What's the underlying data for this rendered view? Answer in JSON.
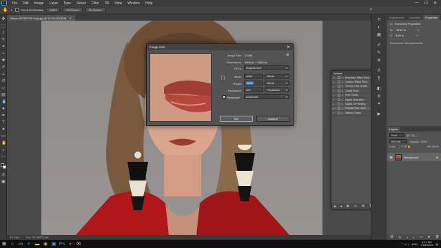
{
  "menu": [
    "File",
    "Edit",
    "Image",
    "Layer",
    "Type",
    "Select",
    "Filter",
    "3D",
    "View",
    "Window",
    "Help"
  ],
  "window_controls": [
    "—",
    "☐",
    "✕"
  ],
  "options": {
    "check_label": "Scroll All Windows",
    "zoom": "100%",
    "fit_screen": "Fit Screen",
    "fill_screen": "Fill Screen"
  },
  "doc_tab": {
    "label": "iStock-997500766 copy.jpg @ 33.3% (RGB/8)",
    "close": "✕"
  },
  "status": {
    "zoom": "33.33%",
    "doc": "Doc: 33.0M/33.0M"
  },
  "props_tabs": [
    "Adjustments",
    "Character",
    "Properties"
  ],
  "props": {
    "heading": "Document Properties",
    "w_label": "W:",
    "w_value": "13.87 in",
    "h_label": "H:",
    "h_value": "8.89 in",
    "res_label": "Resolution: 300 pixels/inch",
    "x_label": "X:",
    "y_label": "Y:"
  },
  "layers": {
    "title": "Layers",
    "kind": "Kind",
    "mode": "Normal",
    "opacity": "Opacity: 100%",
    "lock": "Lock:",
    "fill": "Fill: 100%",
    "background": "Background"
  },
  "actions": {
    "title": "Actions",
    "items": [
      {
        "label": "Animation Effect Phot...",
        "check": "✓",
        "expand": "▸"
      },
      {
        "label": "Cartoon Effect Phot...",
        "check": "✓",
        "expand": "▸"
      },
      {
        "label": "Trendy Color Grade",
        "check": "✓",
        "expand": "▸"
      },
      {
        "label": "Comic Book",
        "check": "✓",
        "expand": "▸"
      },
      {
        "label": "Pixel Game",
        "check": "✓",
        "expand": "▸"
      },
      {
        "label": "Digital Illustration",
        "check": "✓",
        "expand": "▸"
      },
      {
        "label": "Digital Oil Painting",
        "check": "✓",
        "expand": "▸"
      },
      {
        "label": "Portrait Post Lover",
        "check": "✓",
        "expand": "▸"
      },
      {
        "label": "Stained Glass",
        "check": "✓",
        "expand": "▸"
      }
    ]
  },
  "dialog": {
    "title": "Image Size",
    "image_size_label": "Image Size:",
    "image_size_value": "33.0M",
    "dimensions_label": "Dimensions:",
    "dimensions_value": "4000 px × 2662 px",
    "fit_to_label": "Fit To:",
    "fit_to_value": "Original Size",
    "width_label": "Width:",
    "width_value": "4000",
    "width_unit": "Pixels",
    "height_label": "Height:",
    "height_value": "2662",
    "height_unit": "Pixels",
    "res_label": "Resolution:",
    "res_value": "300",
    "res_unit": "Pixels/Inch",
    "resample_label": "Resample:",
    "resample_value": "Automatic",
    "ok": "OK",
    "cancel": "Cancel"
  },
  "taskbar": {
    "time": "5:11 PM",
    "date": "7/16/2019",
    "lang": "ENG"
  },
  "colors": {
    "accent": "#3b6fc1",
    "jacket": "#b0161a",
    "lips": "#a13c34"
  }
}
